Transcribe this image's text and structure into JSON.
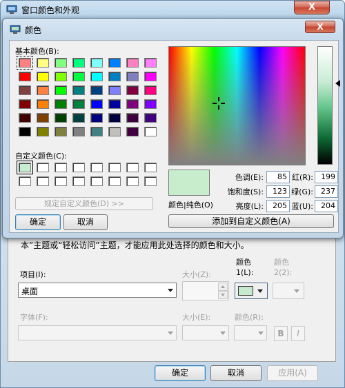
{
  "outer": {
    "title": "窗口颜色和外观",
    "close": "X",
    "note": "本”主题或“轻松访问”主题，才能应用此处选择的颜色和大小。",
    "item_label": "项目(I):",
    "item_value": "桌面",
    "size_label": "大小(Z):",
    "color1_label_line1": "颜色",
    "color1_label_line2": "1(L):",
    "color2_label_line1": "颜色",
    "color2_label_line2": "2(2):",
    "font_label": "字体(F):",
    "font_size_label": "大小(E):",
    "font_color_label": "颜色(R):",
    "bold": "B",
    "italic": "I",
    "ok": "确定",
    "cancel": "取消",
    "apply": "应用(A)",
    "color1_swatch": "#c7e9d0"
  },
  "dialog": {
    "title": "颜色",
    "close": "X",
    "basic_colors_label": "基本颜色(B):",
    "custom_colors_label": "自定义颜色(C):",
    "define_custom_button": "规定自定义颜色(D) >>",
    "ok": "确定",
    "cancel": "取消",
    "add_custom_button": "添加到自定义颜色(A)",
    "preview_label": "颜色|纯色(O)",
    "hue_label": "色调(E):",
    "hue": "85",
    "sat_label": "饱和度(S):",
    "sat": "123",
    "lum_label": "亮度(L):",
    "lum": "205",
    "red_label": "红(R):",
    "red": "199",
    "green_label": "绿(G):",
    "green": "237",
    "blue_label": "蓝(U):",
    "blue": "204",
    "preview_color": "#c7edcc",
    "basic_colors": [
      [
        "#ff8080",
        "#ffff80",
        "#80ff80",
        "#00ff80",
        "#80ffff",
        "#0080ff",
        "#ff80c0",
        "#ff80ff"
      ],
      [
        "#ff0000",
        "#ffff00",
        "#80ff00",
        "#00ff40",
        "#00ffff",
        "#0080c0",
        "#8080c0",
        "#ff00ff"
      ],
      [
        "#804040",
        "#ff8040",
        "#00ff00",
        "#008080",
        "#004080",
        "#8080ff",
        "#800040",
        "#ff0080"
      ],
      [
        "#800000",
        "#ff8000",
        "#008000",
        "#008040",
        "#0000ff",
        "#0000a0",
        "#800080",
        "#8000ff"
      ],
      [
        "#400000",
        "#804000",
        "#004000",
        "#004040",
        "#000080",
        "#000040",
        "#400040",
        "#400080"
      ],
      [
        "#000000",
        "#808000",
        "#808040",
        "#808080",
        "#408080",
        "#c0c0c0",
        "#400040",
        "#ffffff"
      ]
    ],
    "custom_colors": [
      [
        "#c7edd0",
        "#ffffff",
        "#ffffff",
        "#ffffff",
        "#ffffff",
        "#ffffff",
        "#ffffff",
        "#ffffff"
      ],
      [
        "#ffffff",
        "#ffffff",
        "#ffffff",
        "#ffffff",
        "#ffffff",
        "#ffffff",
        "#ffffff",
        "#ffffff"
      ]
    ]
  }
}
